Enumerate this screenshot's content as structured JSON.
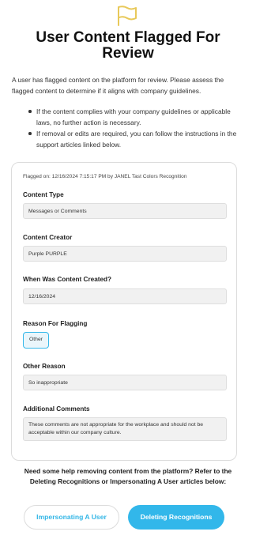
{
  "header": {
    "icon": "flag-icon",
    "accent_color": "#e8c95a",
    "title": "User Content Flagged For Review"
  },
  "intro": "A user has flagged content on the platform for review. Please assess the flagged content to determine if it aligns with company guidelines.",
  "bullets": [
    "If the content complies with your company guidelines or applicable laws, no further action is necessary.",
    "If removal or edits are required, you can follow the instructions in the support articles linked below."
  ],
  "card": {
    "flagged_on": "Flagged on: 12/16/2024 7:15:17 PM by JANEL Tast Colors Recognition",
    "content_type": {
      "label": "Content Type",
      "value": "Messages or Comments"
    },
    "content_creator": {
      "label": "Content Creator",
      "value": "Purple PURPLE"
    },
    "created": {
      "label": "When Was Content Created?",
      "value": "12/16/2024"
    },
    "reason": {
      "label": "Reason For Flagging",
      "value": "Other"
    },
    "other_reason": {
      "label": "Other Reason",
      "value": "So inappropriate"
    },
    "comments": {
      "label": "Additional Comments",
      "value": "These comments are not appropriate for the workplace and should not be acceptable within our company culture."
    }
  },
  "help_text": "Need some help removing content from the platform? Refer to the Deleting Recognitions or Impersonating A User articles below:",
  "buttons": {
    "impersonating": "Impersonating A User",
    "deleting": "Deleting Recognitions"
  },
  "colors": {
    "primary": "#32b7ea",
    "chip_border": "#35b8ea",
    "chip_bg": "#eaf6fb"
  }
}
